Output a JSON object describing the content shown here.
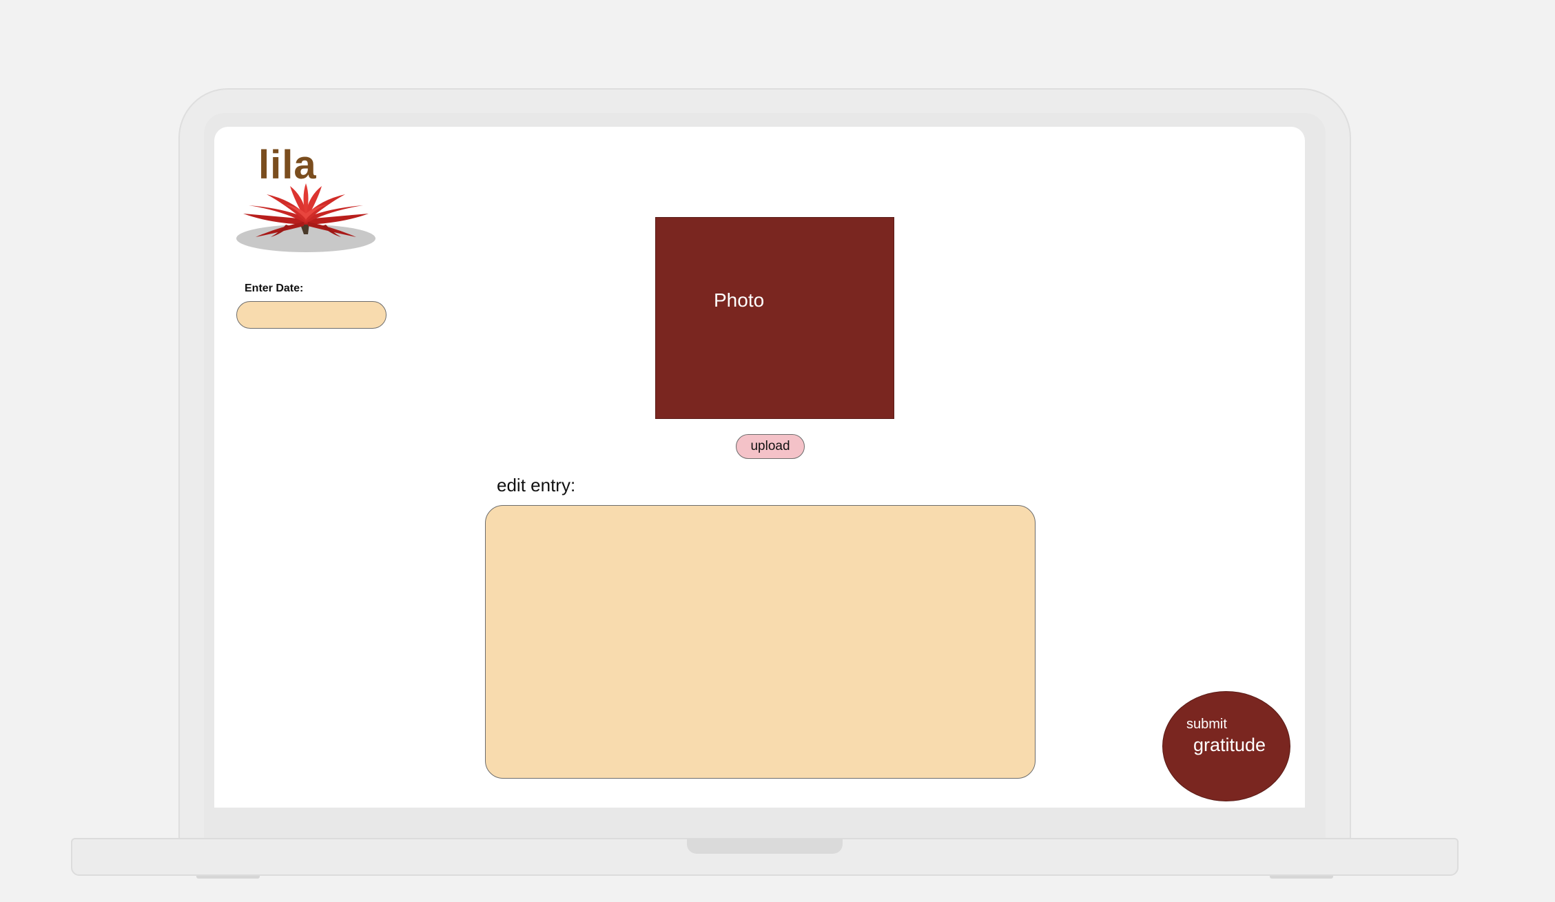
{
  "app": {
    "title": "lila",
    "logo_icon": "lotus-icon"
  },
  "date": {
    "label": "Enter Date:",
    "value": ""
  },
  "photo": {
    "label": "Photo",
    "upload_label": "upload"
  },
  "entry": {
    "label": "edit entry:",
    "value": ""
  },
  "submit": {
    "line1": "submit",
    "line2": "gratitude"
  },
  "colors": {
    "brand_brown": "#7a4d1e",
    "maroon": "#7a2620",
    "peach": "#f8dbae",
    "pink": "#f4c2c8",
    "background": "#f2f2f2"
  }
}
